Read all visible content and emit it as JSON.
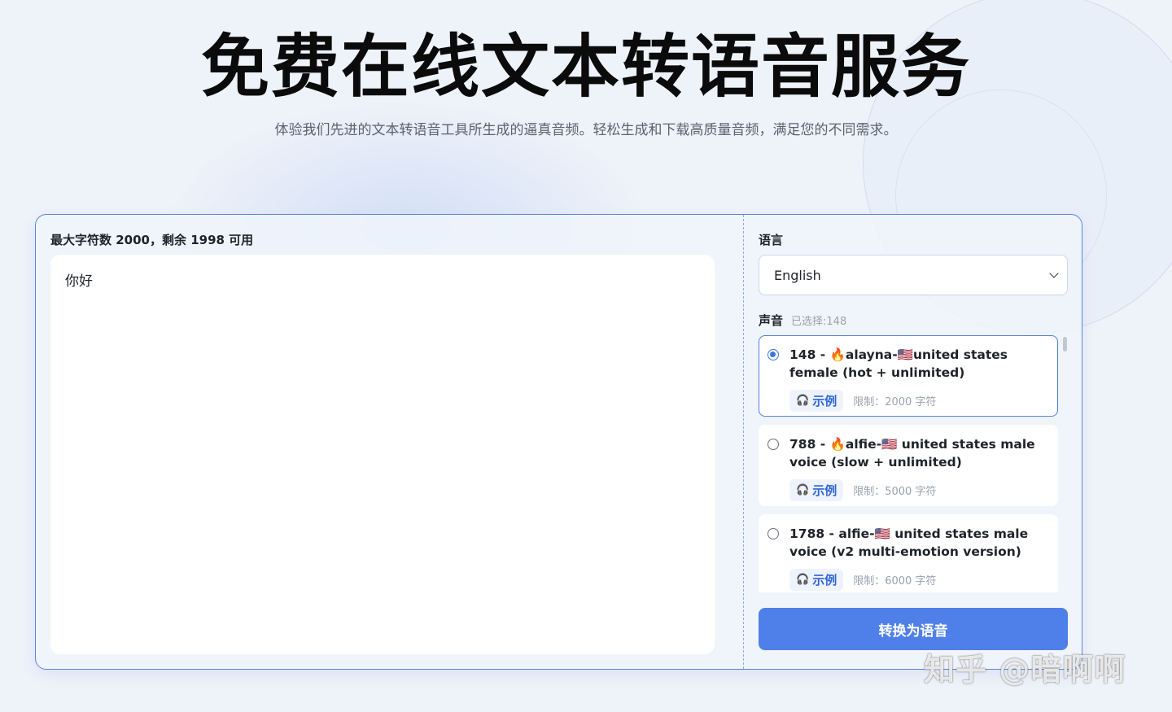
{
  "header": {
    "title": "免费在线文本转语音服务",
    "subtitle": "体验我们先进的文本转语音工具所生成的逼真音频。轻松生成和下载高质量音频，满足您的不同需求。"
  },
  "editor": {
    "char_count_text": "最大字符数 2000，剩余 1998 可用",
    "text": "你好"
  },
  "language": {
    "label": "语言",
    "selected": "English"
  },
  "voice": {
    "label": "声音",
    "selected_text": "已选择:148",
    "items": [
      {
        "name": "148 - 🔥alayna-🇺🇸united states female (hot + unlimited)",
        "sample_label": "示例",
        "limit": "限制：2000 字符",
        "selected": true
      },
      {
        "name": "788 - 🔥alfie-🇺🇸 united states male voice (slow + unlimited)",
        "sample_label": "示例",
        "limit": "限制：5000 字符",
        "selected": false
      },
      {
        "name": "1788 - alfie-🇺🇸 united states male voice (v2 multi-emotion version)",
        "sample_label": "示例",
        "limit": "限制：6000 字符",
        "selected": false
      }
    ]
  },
  "actions": {
    "convert_label": "转换为语音"
  },
  "watermark": "知乎 @暗啊啊",
  "colors": {
    "accent": "#4f7fe9",
    "border": "#5a86dc",
    "background": "#eef2f9"
  }
}
